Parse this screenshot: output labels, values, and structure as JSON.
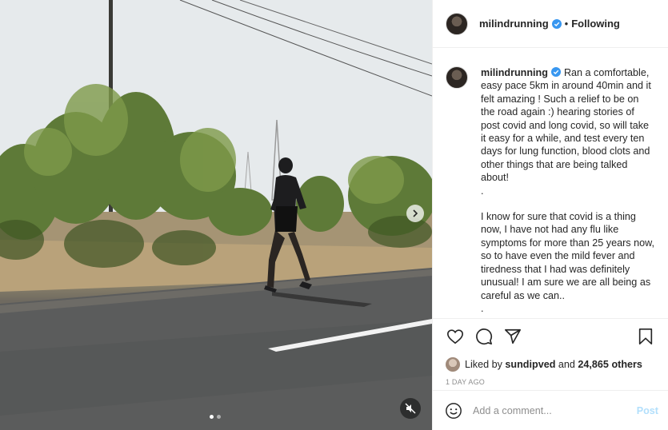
{
  "header": {
    "username": "milindrunning",
    "separator": "•",
    "follow_label": "Following"
  },
  "caption": {
    "username": "milindrunning",
    "paragraph1": "Ran a comfortable, easy pace 5km in around 40min and it felt amazing ! Such a relief to be on the road again :) hearing stories of post covid and long covid, so will take it easy for a while, and test every ten days for lung function, blood clots and other things that are being talked about!",
    "dot1": ".",
    "paragraph2": "I know for sure that covid is a thing now, I have not had any flu like symptoms for more than 25 years now, so to have even the mild fever and tiredness that I had was definitely unusual! I am sure we are all being as careful as we can..",
    "dot2": "."
  },
  "likes": {
    "prefix": "Liked by",
    "liked_by": "sundipved",
    "and": "and",
    "others": "24,865 others"
  },
  "timestamp": "1 DAY AGO",
  "comment": {
    "placeholder": "Add a comment...",
    "post_label": "Post"
  },
  "media": {
    "carousel_count": 2,
    "carousel_active": 1
  },
  "colors": {
    "verified": "#3897f0",
    "post_disabled": "#b2dffc",
    "muted_text": "#8e8e8e"
  },
  "icons": [
    "verified-icon",
    "next-arrow-icon",
    "mute-icon",
    "heart-icon",
    "comment-icon",
    "share-icon",
    "bookmark-icon",
    "emoji-icon"
  ]
}
